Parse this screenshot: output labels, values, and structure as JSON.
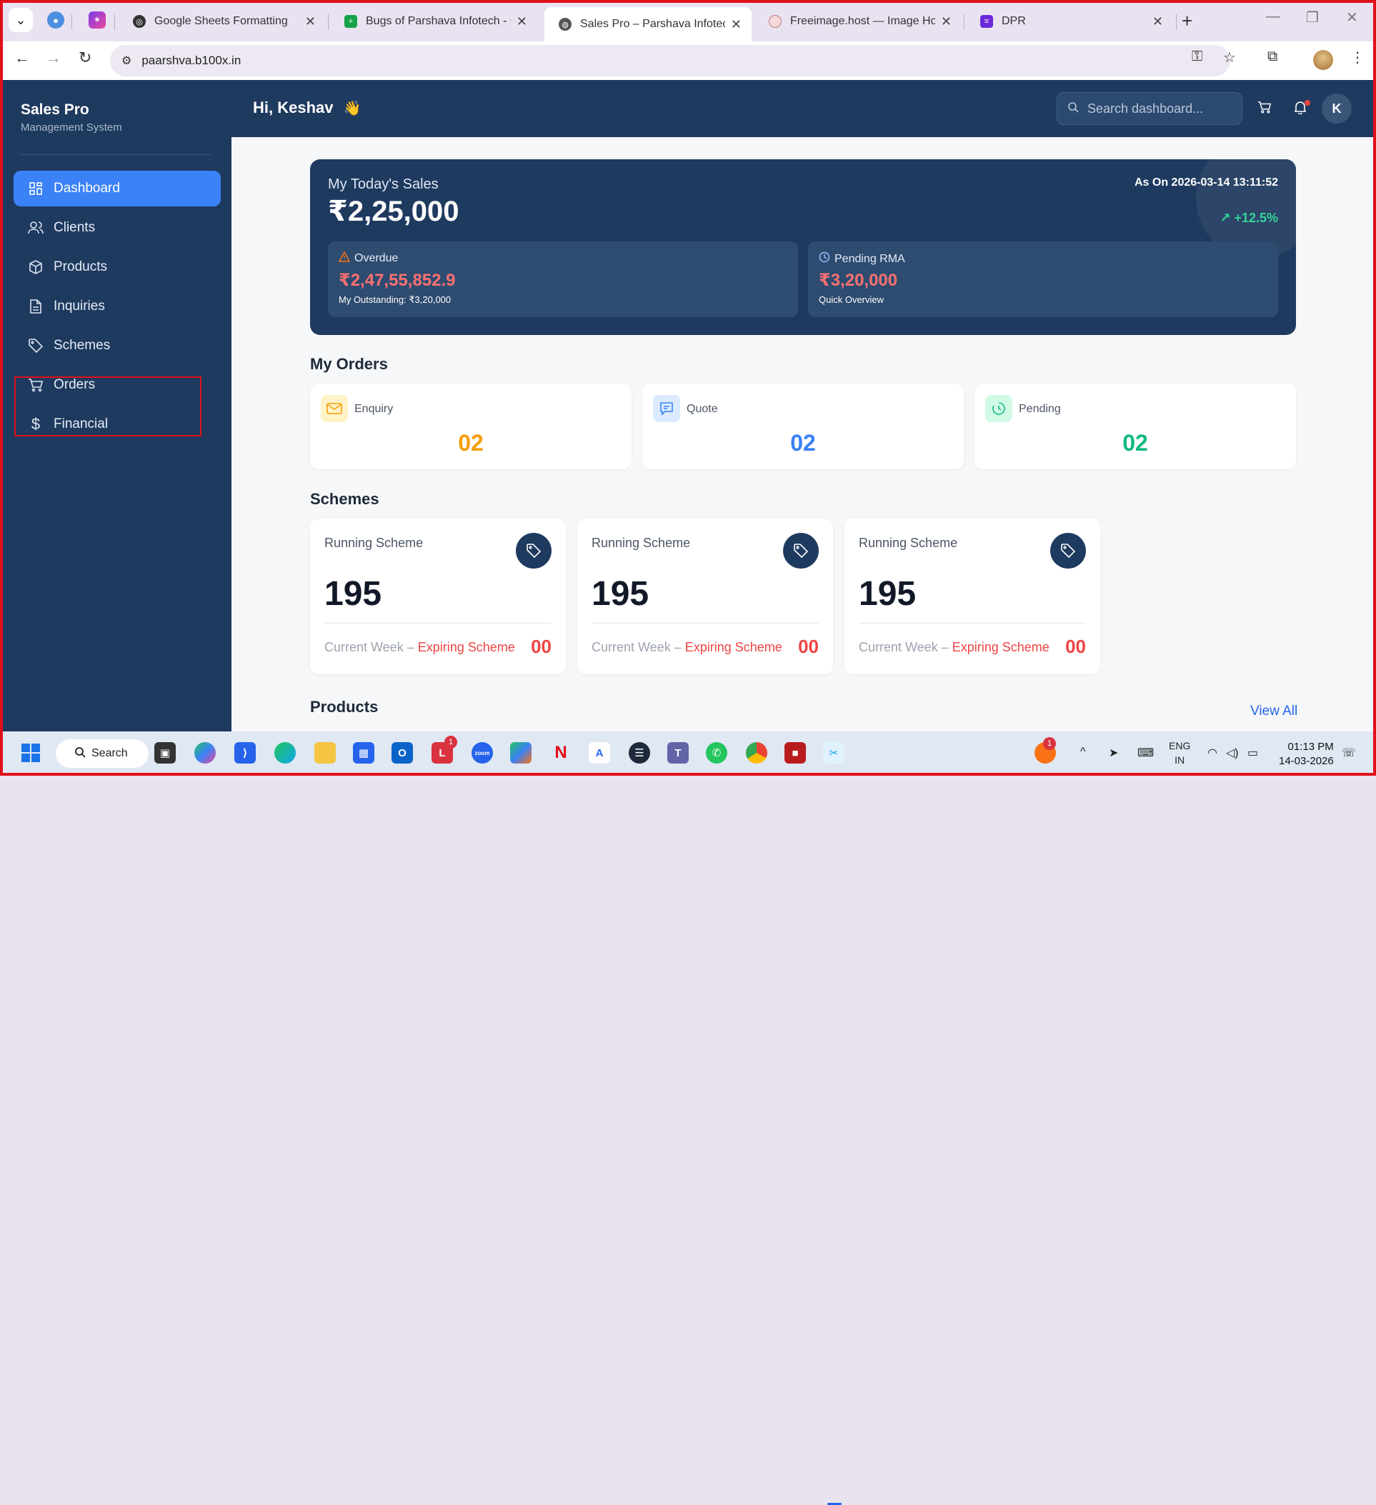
{
  "browser": {
    "tabs": [
      {
        "title": "Google Sheets Formatting"
      },
      {
        "title": "Bugs of Parshava Infotech - Goo"
      },
      {
        "title": "Sales Pro – Parshava Infotech"
      },
      {
        "title": "Freeimage.host — Image Hostin"
      },
      {
        "title": "DPR"
      }
    ],
    "url": "paarshva.b100x.in"
  },
  "app": {
    "brand": "Sales Pro",
    "brand_sub": "Management System",
    "greeting": "Hi, Keshav",
    "greeting_emoji": "👋",
    "search_placeholder": "Search dashboard...",
    "user_initial": "K",
    "nav": [
      {
        "label": "Dashboard",
        "icon": "grid-icon"
      },
      {
        "label": "Clients",
        "icon": "users-icon"
      },
      {
        "label": "Products",
        "icon": "box-icon"
      },
      {
        "label": "Inquiries",
        "icon": "document-icon"
      },
      {
        "label": "Schemes",
        "icon": "tag-icon"
      },
      {
        "label": "Orders",
        "icon": "cart-icon"
      },
      {
        "label": "Financial",
        "icon": "dollar-icon"
      }
    ]
  },
  "sales": {
    "title": "My Today's Sales",
    "value": "₹2,25,000",
    "as_on": "As On 2026-03-14 13:11:52",
    "growth": "+12.5%",
    "overdue": {
      "label": "Overdue",
      "value": "₹2,47,55,852.9",
      "sub": "My Outstanding: ₹3,20,000"
    },
    "pending_rma": {
      "label": "Pending RMA",
      "value": "₹3,20,000",
      "sub": "Quick Overview"
    }
  },
  "orders": {
    "title": "My Orders",
    "cards": [
      {
        "label": "Enquiry",
        "value": "02",
        "color": "#f59e0b"
      },
      {
        "label": "Quote",
        "value": "02",
        "color": "#3b82f6"
      },
      {
        "label": "Pending",
        "value": "02",
        "color": "#10b981"
      }
    ]
  },
  "schemes": {
    "title": "Schemes",
    "cards": [
      {
        "label": "Running Scheme",
        "value": "195",
        "footer": "Current Week – ",
        "footer_exp": "Expiring Scheme",
        "count": "00"
      },
      {
        "label": "Running Scheme",
        "value": "195",
        "footer": "Current Week – ",
        "footer_exp": "Expiring Scheme",
        "count": "00"
      },
      {
        "label": "Running Scheme",
        "value": "195",
        "footer": "Current Week – ",
        "footer_exp": "Expiring Scheme",
        "count": "00"
      }
    ]
  },
  "products": {
    "title": "Products",
    "view_all": "View All"
  },
  "taskbar": {
    "search": "Search",
    "lang": "ENG",
    "region": "IN",
    "time": "01:13 PM",
    "date": "14-03-2026"
  }
}
